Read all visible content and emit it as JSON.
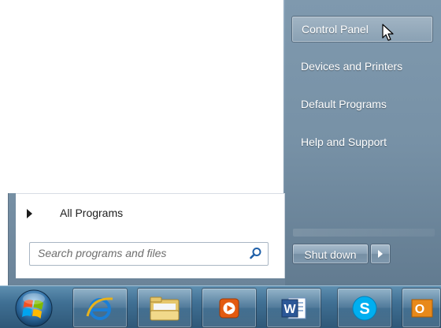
{
  "start_menu": {
    "all_programs_label": "All Programs",
    "search": {
      "placeholder": "Search programs and files",
      "value": ""
    },
    "right_items": [
      {
        "label": "Control Panel",
        "state": "hover"
      },
      {
        "label": "Devices and Printers"
      },
      {
        "label": "Default Programs"
      },
      {
        "label": "Help and Support"
      }
    ],
    "shutdown_label": "Shut down"
  },
  "taskbar": {
    "items": [
      {
        "name": "start-button",
        "icon": "windows-orb-icon"
      },
      {
        "name": "internet-explorer",
        "icon": "internet-explorer-icon"
      },
      {
        "name": "windows-explorer",
        "icon": "folder-icon"
      },
      {
        "name": "media-player",
        "icon": "media-player-icon"
      },
      {
        "name": "microsoft-word",
        "icon": "word-icon",
        "letter": "W"
      },
      {
        "name": "skype",
        "icon": "skype-icon",
        "letter": "S"
      },
      {
        "name": "outlook",
        "icon": "outlook-icon",
        "letter": "O"
      }
    ]
  },
  "colors": {
    "taskbar": "#3f6f93",
    "start_menu_right": "#7f99ae",
    "ie_blue": "#1b7fd6",
    "word_blue": "#2b5797",
    "skype_blue": "#00aff0",
    "outlook_orange": "#e8891a"
  }
}
